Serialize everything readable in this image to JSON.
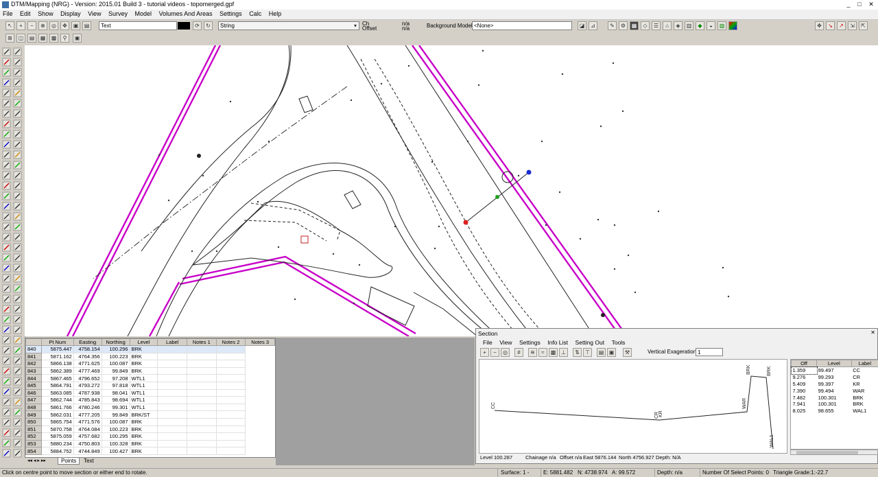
{
  "window": {
    "title": "DTM/Mapping (NRG) - Version: 2015.01 Build 3 - tutorial videos - topomerged.gpf",
    "minimize": "_",
    "maximize": "□",
    "close": "✕"
  },
  "menu": [
    "File",
    "Edit",
    "Show",
    "Display",
    "View",
    "Survey",
    "Model",
    "Volumes And Areas",
    "Settings",
    "Calc",
    "Help"
  ],
  "toolbar": {
    "layer_value": "Text",
    "string_label": "String",
    "ch_label": "Ch",
    "offset_label": "Offset",
    "ch_value": "n/a",
    "offset_value": "n/a",
    "bg_model_label": "Background Model",
    "bg_model_value": "<None>"
  },
  "points_table": {
    "headers": [
      "Pt Num",
      "Easting",
      "Northing",
      "Level",
      "Label",
      "Notes 1",
      "Notes 2",
      "Notes 3"
    ],
    "rows": [
      [
        "840",
        "5875.447",
        "4758.154",
        "100.296",
        "BRK"
      ],
      [
        "841",
        "5871.162",
        "4764.356",
        "100.223",
        "BRK"
      ],
      [
        "842",
        "5866.138",
        "4771.625",
        "100.087",
        "BRK"
      ],
      [
        "843",
        "5862.389",
        "4777.469",
        "99.849",
        "BRK"
      ],
      [
        "844",
        "5867.465",
        "4796.652",
        "97.208",
        "WTL1"
      ],
      [
        "845",
        "5864.791",
        "4793.272",
        "97.818",
        "WTL1"
      ],
      [
        "846",
        "5863.085",
        "4787.938",
        "98.041",
        "WTL1"
      ],
      [
        "847",
        "5862.744",
        "4785.843",
        "98.694",
        "WTL1"
      ],
      [
        "848",
        "5861.766",
        "4780.246",
        "99.301",
        "WTL1"
      ],
      [
        "849",
        "5862.031",
        "4777.205",
        "99.849",
        "BRK/ST"
      ],
      [
        "850",
        "5865.754",
        "4771.576",
        "100.087",
        "BRK"
      ],
      [
        "851",
        "5870.758",
        "4764.084",
        "100.223",
        "BRK"
      ],
      [
        "852",
        "5875.059",
        "4757.682",
        "100.295",
        "BRK"
      ],
      [
        "853",
        "5880.234",
        "4750.803",
        "100.328",
        "BRK"
      ],
      [
        "854",
        "5884.752",
        "4744.849",
        "100.427",
        "BRK"
      ]
    ],
    "selected_index": 0,
    "tabs": [
      "Points",
      "Text"
    ]
  },
  "section": {
    "title": "Section",
    "menu": [
      "File",
      "View",
      "Settings",
      "Info List",
      "Setting Out",
      "Tools"
    ],
    "vert_exag_label": "Vertical Exageration",
    "vert_exag_value": "1",
    "table_headers": [
      "Off",
      "Level",
      "Label"
    ],
    "table_rows": [
      [
        "1.359",
        "99.497",
        "CC"
      ],
      [
        "9.276",
        "99.293",
        "CR"
      ],
      [
        "5.409",
        "99.397",
        "KR"
      ],
      [
        "7.390",
        "99.494",
        "WAR"
      ],
      [
        "7.482",
        "100.301",
        "BRK"
      ],
      [
        "7.941",
        "100.301",
        "BRK"
      ],
      [
        "8.025",
        "98.655",
        "WAL1"
      ]
    ],
    "plot_labels": [
      "CC",
      "CR",
      "KR",
      "WAR",
      "BRK",
      "BRK",
      "WAL1"
    ],
    "status": {
      "level": "Level 100.287",
      "chainage": "Chainage n/a",
      "offset": "Offset n/a",
      "east": "East 5876.144",
      "north": "North 4756.927",
      "depth": "Depth: N/A"
    }
  },
  "statusbar": {
    "message": "Click on centre point to move section or either end to rotate.",
    "surface": "Surface: 1 -",
    "east": "E: 5881.482",
    "north": "N: 4738.974",
    "alt": "A: 99.572",
    "depth": "Depth: n/a",
    "select_points": "Number Of Select Points: 0",
    "triangle_grade": "Triangle Grade:1:-22.7"
  },
  "colors": {
    "boundary": "#c800c8",
    "accent_blue": "#1a2cd0",
    "marker_red": "#e02020",
    "marker_green": "#20a020"
  }
}
